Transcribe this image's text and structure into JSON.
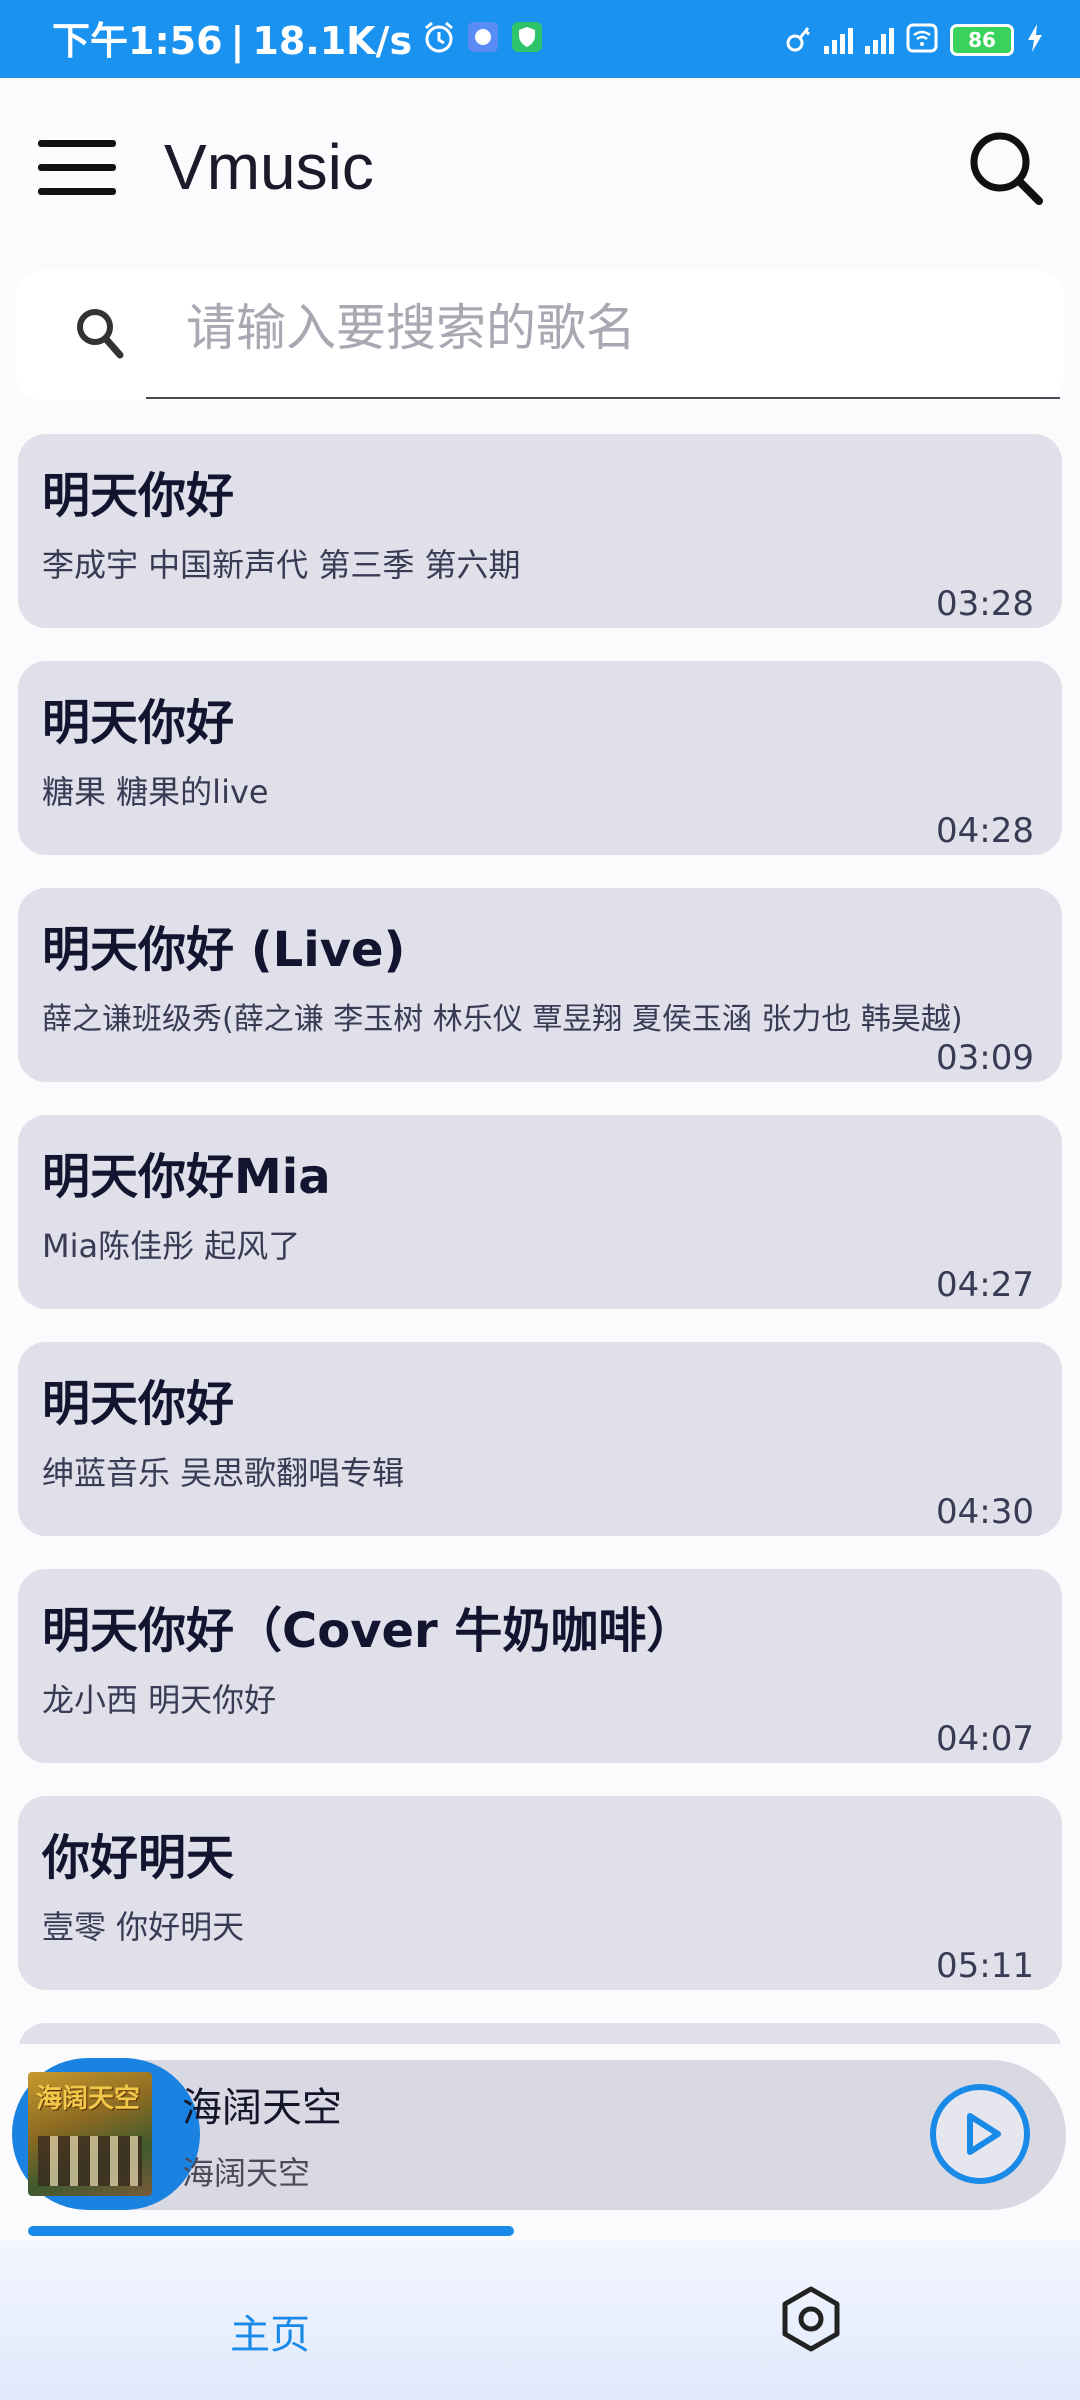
{
  "status_bar": {
    "time": "下午1:56",
    "speed": "18.1K/s",
    "battery": "86"
  },
  "app_bar": {
    "title": "Vmusic"
  },
  "search": {
    "placeholder": "请输入要搜索的歌名",
    "value": ""
  },
  "songs": [
    {
      "title": "明天你好",
      "artist": "李成宇  中国新声代   第三季     第六期",
      "duration": "03:28"
    },
    {
      "title": "明天你好",
      "artist": "糖果  糖果的live",
      "duration": "04:28"
    },
    {
      "title": "明天你好 (Live)",
      "artist": "薛之谦班级秀(薛之谦 李玉树 林乐仪 覃昱翔 夏侯玉涵 张力也 韩昊越)",
      "duration": "03:09"
    },
    {
      "title": "明天你好Mia",
      "artist": "Mia陈佳彤  起风了",
      "duration": "04:27"
    },
    {
      "title": "明天你好",
      "artist": "绅蓝音乐  吴思歌翻唱专辑",
      "duration": "04:30"
    },
    {
      "title": "明天你好（Cover 牛奶咖啡）",
      "artist": "龙小西  明天你好",
      "duration": "04:07"
    },
    {
      "title": "你好明天",
      "artist": "壹零  你好明天",
      "duration": "05:11"
    },
    {
      "title": "",
      "artist": "",
      "duration": ""
    }
  ],
  "now_playing": {
    "title": "海阔天空",
    "artist": "海阔天空",
    "cover_text": "海阔天空",
    "progress": 0.45
  },
  "bottom_nav": {
    "home_label": "主页"
  },
  "colors": {
    "status_bar": "#1992f0",
    "accent": "#1a8ae8",
    "card": "#e0e0ea"
  },
  "icons": [
    "menu-icon",
    "search-icon",
    "play-icon",
    "settings-icon",
    "alarm-icon",
    "wifi-icon",
    "battery-icon",
    "charging-icon"
  ]
}
